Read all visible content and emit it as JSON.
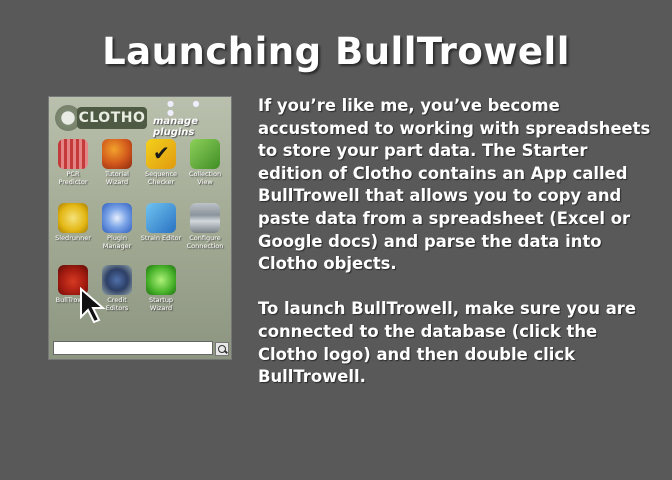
{
  "slide": {
    "title": "Launching BullTrowell",
    "paragraphs": [
      "If you’re like me, you’ve become accustomed to working with spreadsheets to store your part data. The Starter edition of Clotho contains an App called BullTrowell that allows you to copy and paste data from a spreadsheet (Excel or Google docs) and parse the data into Clotho objects.",
      "To launch BullTrowell, make sure you are connected to the database (click the Clotho logo) and then double click BullTrowell."
    ]
  },
  "clotho": {
    "logo": "CLOTHO",
    "manage_plugins": "manage plugins",
    "window_dots": "● ● ●",
    "apps": [
      {
        "label": "PCR Predictor",
        "icon": "pcr-dna-icon"
      },
      {
        "label": "Tutorial Wizard",
        "icon": "pineapple-icon"
      },
      {
        "label": "Sequence Checker",
        "icon": "checkmark-icon"
      },
      {
        "label": "Collection View",
        "icon": "folder-icon"
      },
      {
        "label": "Sledrunner",
        "icon": "sled-icon"
      },
      {
        "label": "Plugin Manager",
        "icon": "plugin-icon"
      },
      {
        "label": "Strain Editor",
        "icon": "strain-icon"
      },
      {
        "label": "Configure Connection",
        "icon": "database-icon"
      },
      {
        "label": "BullTrowell",
        "icon": "bull-icon"
      },
      {
        "label": "Credit Editors",
        "icon": "credit-icon"
      },
      {
        "label": "Startup Wizard",
        "icon": "power-icon"
      }
    ],
    "search_placeholder": ""
  },
  "colors": {
    "background": "#595959",
    "text": "#ffffff"
  }
}
